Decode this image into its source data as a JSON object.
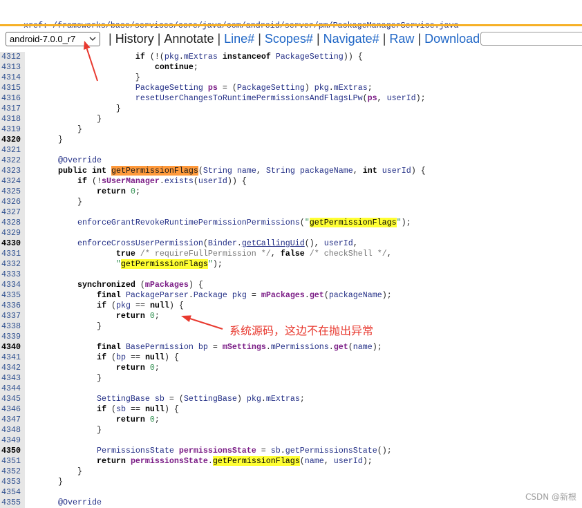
{
  "header": {
    "xref_label": "xref:",
    "path": "/frameworks/base/services/core/java/com/android/server/pm/PackageManagerService.java"
  },
  "toolbar": {
    "version_select": {
      "selected": "android-7.0.0_r7"
    },
    "separator": "|",
    "nav": [
      "History",
      "Annotate",
      "Line#",
      "Scopes#",
      "Navigate#",
      "Raw",
      "Download"
    ]
  },
  "colors": {
    "rule": "#f6b026",
    "link": "#1f66c6",
    "annotation": "#e8392f",
    "search_highlight": "#ffff33",
    "definition_highlight": "#ff9a3c"
  },
  "code": {
    "lines": [
      {
        "num": "4312",
        "tokens": [
          {
            "p": "                    "
          },
          {
            "k": "if"
          },
          {
            "p": " (!("
          },
          {
            "i": "pkg"
          },
          {
            "p": "."
          },
          {
            "i": "mExtras"
          },
          {
            "p": " "
          },
          {
            "k": "instanceof"
          },
          {
            "p": " "
          },
          {
            "i": "PackageSetting"
          },
          {
            "p": ")) {"
          }
        ]
      },
      {
        "num": "4313",
        "tokens": [
          {
            "p": "                        "
          },
          {
            "k": "continue"
          },
          {
            "p": ";"
          }
        ]
      },
      {
        "num": "4314",
        "tokens": [
          {
            "p": "                    }"
          }
        ]
      },
      {
        "num": "4315",
        "tokens": [
          {
            "p": "                    "
          },
          {
            "i": "PackageSetting"
          },
          {
            "p": " "
          },
          {
            "f": "ps"
          },
          {
            "p": " = ("
          },
          {
            "i": "PackageSetting"
          },
          {
            "p": ") "
          },
          {
            "i": "pkg"
          },
          {
            "p": "."
          },
          {
            "i": "mExtras"
          },
          {
            "p": ";"
          }
        ]
      },
      {
        "num": "4316",
        "tokens": [
          {
            "p": "                    "
          },
          {
            "i": "resetUserChangesToRuntimePermissionsAndFlagsLPw"
          },
          {
            "p": "("
          },
          {
            "f": "ps"
          },
          {
            "p": ", "
          },
          {
            "i": "userId"
          },
          {
            "p": ");"
          }
        ]
      },
      {
        "num": "4317",
        "tokens": [
          {
            "p": "                }"
          }
        ]
      },
      {
        "num": "4318",
        "tokens": [
          {
            "p": "            }"
          }
        ]
      },
      {
        "num": "4319",
        "tokens": [
          {
            "p": "        }"
          }
        ]
      },
      {
        "num": "4320",
        "tokens": [
          {
            "p": "    }"
          }
        ]
      },
      {
        "num": "4321",
        "tokens": []
      },
      {
        "num": "4322",
        "tokens": [
          {
            "p": "    "
          },
          {
            "a": "@Override"
          }
        ]
      },
      {
        "num": "4323",
        "tokens": [
          {
            "p": "    "
          },
          {
            "k": "public"
          },
          {
            "p": " "
          },
          {
            "k": "int"
          },
          {
            "p": " "
          },
          {
            "hd": "getPermissionFlags"
          },
          {
            "p": "("
          },
          {
            "i": "String"
          },
          {
            "p": " "
          },
          {
            "i": "name"
          },
          {
            "p": ", "
          },
          {
            "i": "String"
          },
          {
            "p": " "
          },
          {
            "i": "packageName"
          },
          {
            "p": ", "
          },
          {
            "k": "int"
          },
          {
            "p": " "
          },
          {
            "i": "userId"
          },
          {
            "p": ") {"
          }
        ]
      },
      {
        "num": "4324",
        "tokens": [
          {
            "p": "        "
          },
          {
            "k": "if"
          },
          {
            "p": " (!"
          },
          {
            "f": "sUserManager"
          },
          {
            "p": "."
          },
          {
            "i": "exists"
          },
          {
            "p": "("
          },
          {
            "i": "userId"
          },
          {
            "p": ")) {"
          }
        ]
      },
      {
        "num": "4325",
        "tokens": [
          {
            "p": "            "
          },
          {
            "k": "return"
          },
          {
            "p": " "
          },
          {
            "n": "0"
          },
          {
            "p": ";"
          }
        ]
      },
      {
        "num": "4326",
        "tokens": [
          {
            "p": "        }"
          }
        ]
      },
      {
        "num": "4327",
        "tokens": []
      },
      {
        "num": "4328",
        "tokens": [
          {
            "p": "        "
          },
          {
            "i": "enforceGrantRevokeRuntimePermissionPermissions"
          },
          {
            "p": "("
          },
          {
            "s": "\""
          },
          {
            "hs": "getPermissionFlags"
          },
          {
            "s": "\""
          },
          {
            "p": ");"
          }
        ]
      },
      {
        "num": "4329",
        "tokens": []
      },
      {
        "num": "4330",
        "tokens": [
          {
            "p": "        "
          },
          {
            "i": "enforceCrossUserPermission"
          },
          {
            "p": "("
          },
          {
            "i": "Binder"
          },
          {
            "p": "."
          },
          {
            "u": "getCallingUid"
          },
          {
            "p": "(), "
          },
          {
            "i": "userId"
          },
          {
            "p": ","
          }
        ]
      },
      {
        "num": "4331",
        "tokens": [
          {
            "p": "                "
          },
          {
            "k": "true"
          },
          {
            "p": " "
          },
          {
            "c": "/* requireFullPermission */"
          },
          {
            "p": ", "
          },
          {
            "k": "false"
          },
          {
            "p": " "
          },
          {
            "c": "/* checkShell */"
          },
          {
            "p": ","
          }
        ]
      },
      {
        "num": "4332",
        "tokens": [
          {
            "p": "                "
          },
          {
            "s": "\""
          },
          {
            "hs": "getPermissionFlags"
          },
          {
            "s": "\""
          },
          {
            "p": ");"
          }
        ]
      },
      {
        "num": "4333",
        "tokens": []
      },
      {
        "num": "4334",
        "tokens": [
          {
            "p": "        "
          },
          {
            "k": "synchronized"
          },
          {
            "p": " ("
          },
          {
            "f": "mPackages"
          },
          {
            "p": ") {"
          }
        ]
      },
      {
        "num": "4335",
        "tokens": [
          {
            "p": "            "
          },
          {
            "k": "final"
          },
          {
            "p": " "
          },
          {
            "i": "PackageParser"
          },
          {
            "p": "."
          },
          {
            "i": "Package"
          },
          {
            "p": " "
          },
          {
            "i": "pkg"
          },
          {
            "p": " = "
          },
          {
            "f": "mPackages"
          },
          {
            "p": "."
          },
          {
            "f": "get"
          },
          {
            "p": "("
          },
          {
            "i": "packageName"
          },
          {
            "p": ");"
          }
        ]
      },
      {
        "num": "4336",
        "tokens": [
          {
            "p": "            "
          },
          {
            "k": "if"
          },
          {
            "p": " ("
          },
          {
            "i": "pkg"
          },
          {
            "p": " == "
          },
          {
            "k": "null"
          },
          {
            "p": ") {"
          }
        ]
      },
      {
        "num": "4337",
        "tokens": [
          {
            "p": "                "
          },
          {
            "k": "return"
          },
          {
            "p": " "
          },
          {
            "n": "0"
          },
          {
            "p": ";"
          }
        ]
      },
      {
        "num": "4338",
        "tokens": [
          {
            "p": "            }"
          }
        ]
      },
      {
        "num": "4339",
        "tokens": []
      },
      {
        "num": "4340",
        "tokens": [
          {
            "p": "            "
          },
          {
            "k": "final"
          },
          {
            "p": " "
          },
          {
            "i": "BasePermission"
          },
          {
            "p": " "
          },
          {
            "i": "bp"
          },
          {
            "p": " = "
          },
          {
            "f": "mSettings"
          },
          {
            "p": "."
          },
          {
            "i": "mPermissions"
          },
          {
            "p": "."
          },
          {
            "f": "get"
          },
          {
            "p": "("
          },
          {
            "i": "name"
          },
          {
            "p": ");"
          }
        ]
      },
      {
        "num": "4341",
        "tokens": [
          {
            "p": "            "
          },
          {
            "k": "if"
          },
          {
            "p": " ("
          },
          {
            "i": "bp"
          },
          {
            "p": " == "
          },
          {
            "k": "null"
          },
          {
            "p": ") {"
          }
        ]
      },
      {
        "num": "4342",
        "tokens": [
          {
            "p": "                "
          },
          {
            "k": "return"
          },
          {
            "p": " "
          },
          {
            "n": "0"
          },
          {
            "p": ";"
          }
        ]
      },
      {
        "num": "4343",
        "tokens": [
          {
            "p": "            }"
          }
        ]
      },
      {
        "num": "4344",
        "tokens": []
      },
      {
        "num": "4345",
        "tokens": [
          {
            "p": "            "
          },
          {
            "i": "SettingBase"
          },
          {
            "p": " "
          },
          {
            "i": "sb"
          },
          {
            "p": " = ("
          },
          {
            "i": "SettingBase"
          },
          {
            "p": ") "
          },
          {
            "i": "pkg"
          },
          {
            "p": "."
          },
          {
            "i": "mExtras"
          },
          {
            "p": ";"
          }
        ]
      },
      {
        "num": "4346",
        "tokens": [
          {
            "p": "            "
          },
          {
            "k": "if"
          },
          {
            "p": " ("
          },
          {
            "i": "sb"
          },
          {
            "p": " == "
          },
          {
            "k": "null"
          },
          {
            "p": ") {"
          }
        ]
      },
      {
        "num": "4347",
        "tokens": [
          {
            "p": "                "
          },
          {
            "k": "return"
          },
          {
            "p": " "
          },
          {
            "n": "0"
          },
          {
            "p": ";"
          }
        ]
      },
      {
        "num": "4348",
        "tokens": [
          {
            "p": "            }"
          }
        ]
      },
      {
        "num": "4349",
        "tokens": []
      },
      {
        "num": "4350",
        "tokens": [
          {
            "p": "            "
          },
          {
            "i": "PermissionsState"
          },
          {
            "p": " "
          },
          {
            "f": "permissionsState"
          },
          {
            "p": " = "
          },
          {
            "i": "sb"
          },
          {
            "p": "."
          },
          {
            "i": "getPermissionsState"
          },
          {
            "p": "();"
          }
        ]
      },
      {
        "num": "4351",
        "tokens": [
          {
            "p": "            "
          },
          {
            "k": "return"
          },
          {
            "p": " "
          },
          {
            "f": "permissionsState"
          },
          {
            "p": "."
          },
          {
            "hs": "getPermissionFlags"
          },
          {
            "p": "("
          },
          {
            "i": "name"
          },
          {
            "p": ", "
          },
          {
            "i": "userId"
          },
          {
            "p": ");"
          }
        ]
      },
      {
        "num": "4352",
        "tokens": [
          {
            "p": "        }"
          }
        ]
      },
      {
        "num": "4353",
        "tokens": [
          {
            "p": "    }"
          }
        ]
      },
      {
        "num": "4354",
        "tokens": []
      },
      {
        "num": "4355",
        "tokens": [
          {
            "p": "    "
          },
          {
            "a": "@Override"
          }
        ]
      }
    ]
  },
  "annotation": {
    "note": "系统源码，这边不在抛出异常"
  },
  "watermark": "CSDN @新根"
}
